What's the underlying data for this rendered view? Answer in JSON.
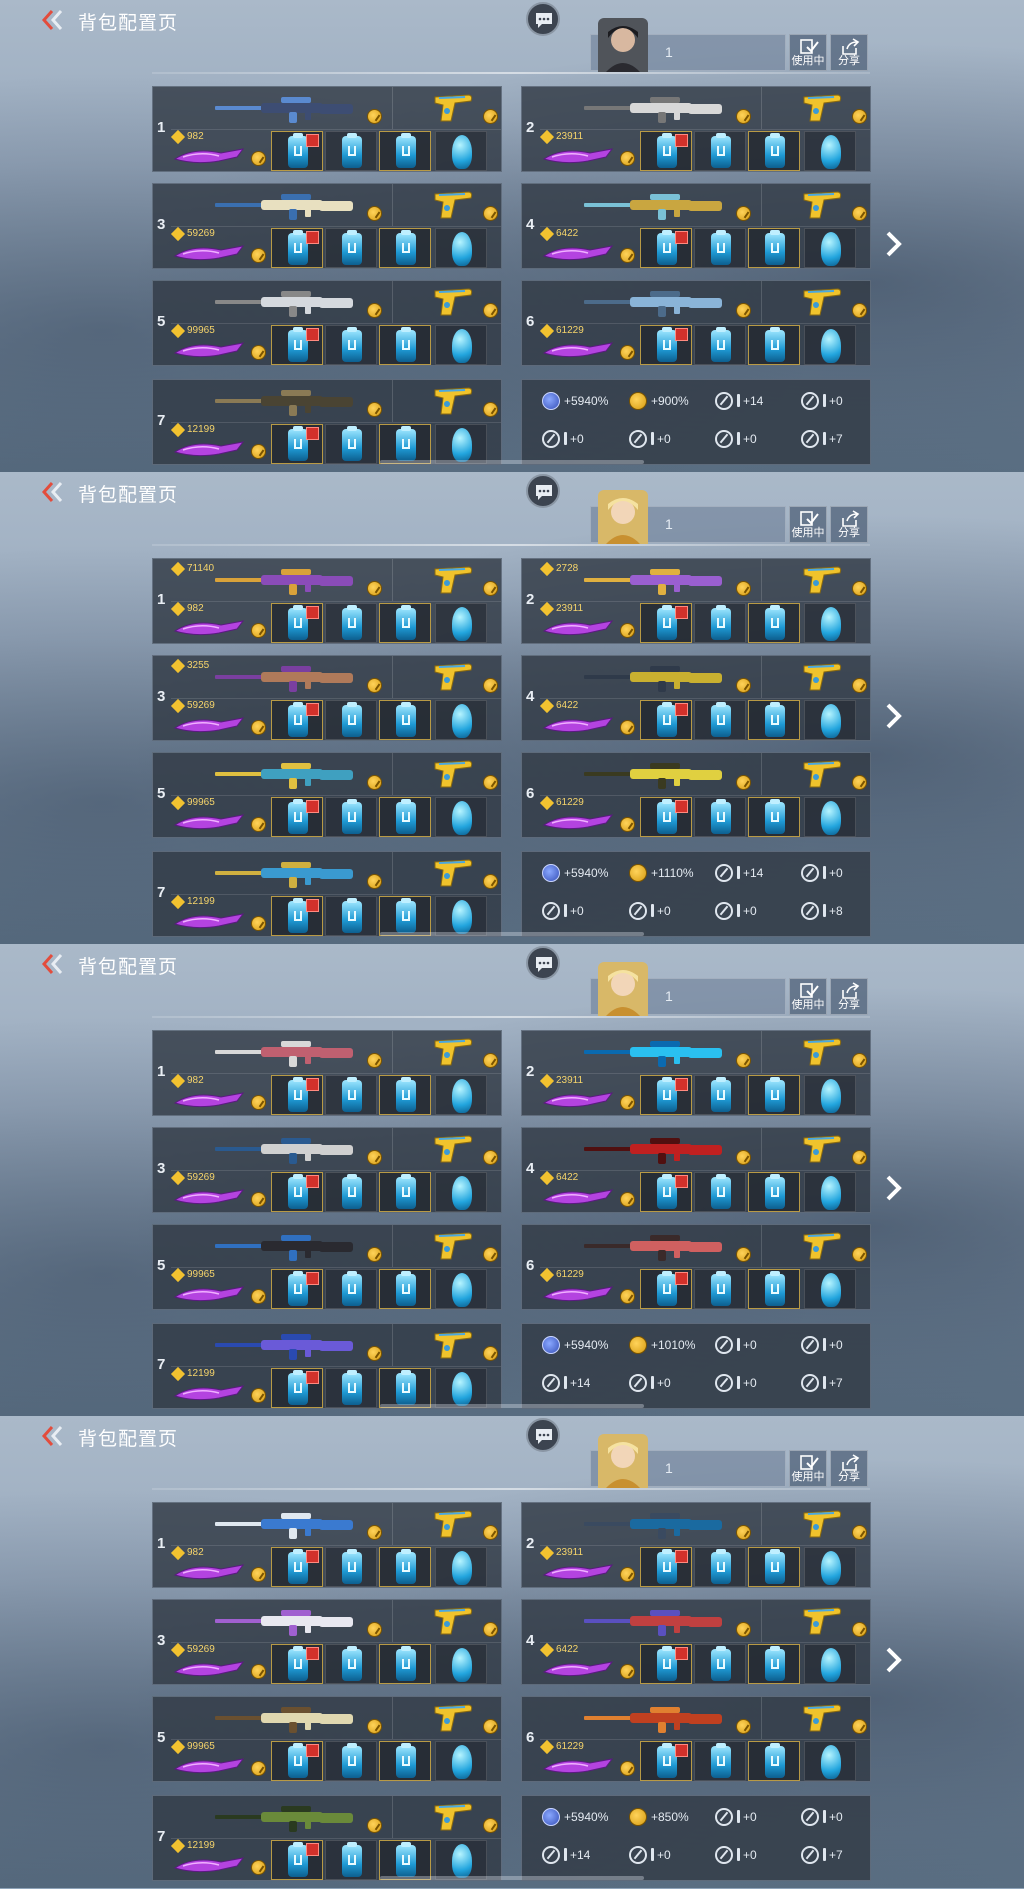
{
  "page_title": "背包配置页",
  "name_value": "1",
  "btn_inuse": "使用中",
  "btn_share": "分享",
  "colors": {
    "accent_red": "#e34c3c",
    "gold": "#f2c230",
    "cyan": "#22a5de"
  },
  "icons": {
    "back": "double-chevron-left-icon",
    "chat": "chat-bubble-icon",
    "next": "chevron-right-icon"
  },
  "panels": [
    {
      "avatar": "male-character-avatar",
      "loadouts": [
        {
          "num": "1",
          "score": "982",
          "score_top": ""
        },
        {
          "num": "2",
          "score": "23911",
          "score_top": ""
        },
        {
          "num": "3",
          "score": "59269",
          "score_top": ""
        },
        {
          "num": "4",
          "score": "6422",
          "score_top": ""
        },
        {
          "num": "5",
          "score": "99965",
          "score_top": ""
        },
        {
          "num": "6",
          "score": "61229",
          "score_top": ""
        },
        {
          "num": "7",
          "score": "12199",
          "score_top": ""
        }
      ],
      "stats": [
        "+5940%",
        "+900%",
        "+14",
        "+0",
        "+0",
        "+0",
        "+0",
        "+7"
      ]
    },
    {
      "avatar": "female-character-avatar",
      "loadouts": [
        {
          "num": "1",
          "score": "982",
          "score_top": "71140"
        },
        {
          "num": "2",
          "score": "23911",
          "score_top": "2728"
        },
        {
          "num": "3",
          "score": "59269",
          "score_top": "3255"
        },
        {
          "num": "4",
          "score": "6422",
          "score_top": ""
        },
        {
          "num": "5",
          "score": "99965",
          "score_top": ""
        },
        {
          "num": "6",
          "score": "61229",
          "score_top": ""
        },
        {
          "num": "7",
          "score": "12199",
          "score_top": ""
        }
      ],
      "stats": [
        "+5940%",
        "+1110%",
        "+14",
        "+0",
        "+0",
        "+0",
        "+0",
        "+8"
      ]
    },
    {
      "avatar": "female-character-avatar",
      "loadouts": [
        {
          "num": "1",
          "score": "982",
          "score_top": ""
        },
        {
          "num": "2",
          "score": "23911",
          "score_top": ""
        },
        {
          "num": "3",
          "score": "59269",
          "score_top": ""
        },
        {
          "num": "4",
          "score": "6422",
          "score_top": ""
        },
        {
          "num": "5",
          "score": "99965",
          "score_top": ""
        },
        {
          "num": "6",
          "score": "61229",
          "score_top": ""
        },
        {
          "num": "7",
          "score": "12199",
          "score_top": ""
        }
      ],
      "stats": [
        "+5940%",
        "+1010%",
        "+0",
        "+0",
        "+14",
        "+0",
        "+0",
        "+7"
      ]
    },
    {
      "avatar": "female-character-avatar",
      "loadouts": [
        {
          "num": "1",
          "score": "982",
          "score_top": ""
        },
        {
          "num": "2",
          "score": "23911",
          "score_top": ""
        },
        {
          "num": "3",
          "score": "59269",
          "score_top": ""
        },
        {
          "num": "4",
          "score": "6422",
          "score_top": ""
        },
        {
          "num": "5",
          "score": "99965",
          "score_top": ""
        },
        {
          "num": "6",
          "score": "61229",
          "score_top": ""
        },
        {
          "num": "7",
          "score": "12199",
          "score_top": ""
        }
      ],
      "stats": [
        "+5940%",
        "+850%",
        "+0",
        "+0",
        "+14",
        "+0",
        "+0",
        "+7"
      ]
    }
  ]
}
